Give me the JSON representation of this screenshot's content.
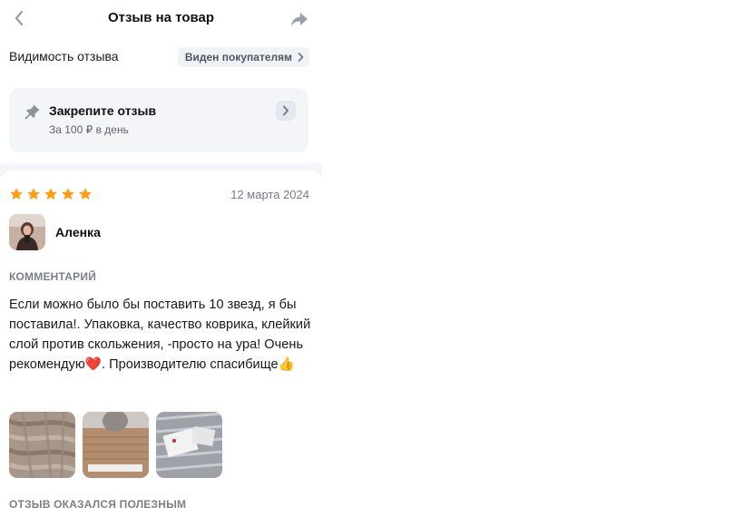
{
  "header": {
    "title": "Отзыв на товар",
    "back_icon": "chevron-left-icon",
    "share_icon": "share-arrow-icon"
  },
  "visibility": {
    "label": "Видимость отзыва",
    "value": "Виден покупателям"
  },
  "pin": {
    "title": "Закрепите отзыв",
    "subtitle": "За 100 ₽ в день",
    "icon": "pin-icon"
  },
  "review": {
    "rating": 5,
    "rating_max": 5,
    "date": "12 марта 2024",
    "author": "Аленка",
    "comment_label": "КОММЕНТАРИЙ",
    "comment": "Если можно было бы поставить 10 звезд, я бы поставила!. Упаковка, качество коврика, клейкий слой против скольжения, -просто на ура! Очень рекомендую❤️. Производителю спасибище👍",
    "photos_count": 3,
    "helpful_label": "ОТЗЫВ ОКАЗАЛСЯ ПОЛЕЗНЫМ"
  },
  "colors": {
    "star": "#ff9e0d",
    "card_bg": "#f4f5f8",
    "chip_bg": "#f0f2f6",
    "muted_text": "#7a7f8a"
  }
}
